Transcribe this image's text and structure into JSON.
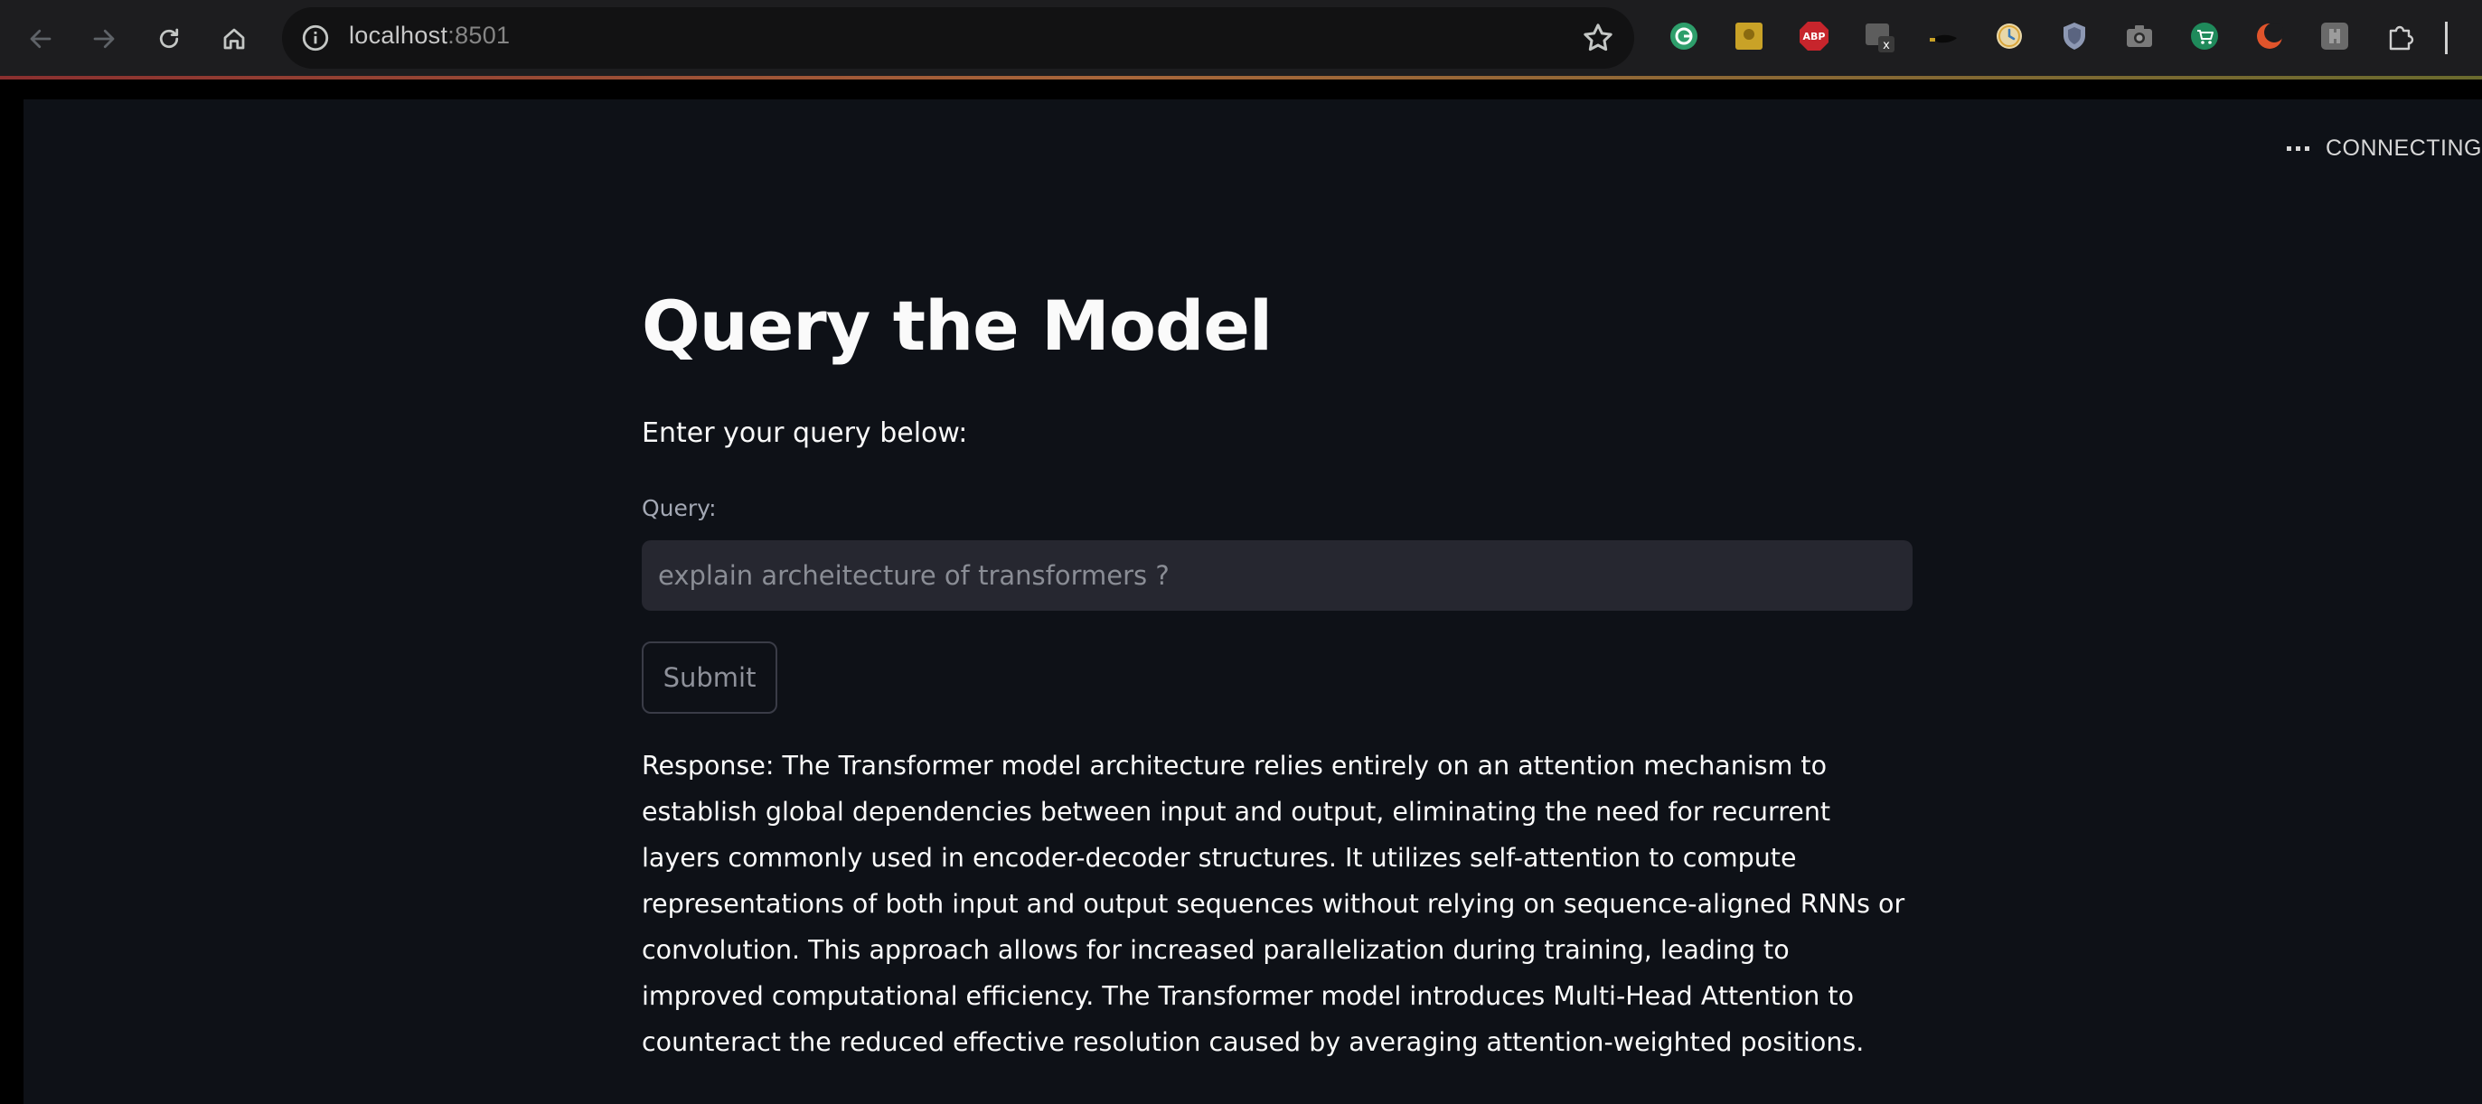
{
  "browser": {
    "url_host": "localhost",
    "url_port": ":8501",
    "nav_icons": [
      "back-arrow-icon",
      "forward-arrow-icon",
      "reload-icon",
      "home-icon"
    ],
    "extensions": [
      {
        "name": "grammarly-icon",
        "color": "#2e9e6b"
      },
      {
        "name": "sticky-note-icon",
        "color": "#c9a227"
      },
      {
        "name": "adblock-plus-icon",
        "color": "#c7252c",
        "label": "ABP"
      },
      {
        "name": "tab-manager-icon",
        "color": "#5d5d5d"
      },
      {
        "name": "whale-icon",
        "color": "#1a1a1a"
      },
      {
        "name": "clock-icon",
        "color": "#d9a53a"
      },
      {
        "name": "shield-icon",
        "color": "#8d98b3"
      },
      {
        "name": "camera-icon",
        "color": "#7a7a7a"
      },
      {
        "name": "cart-icon",
        "color": "#1f8a5b"
      },
      {
        "name": "moon-icon",
        "color": "#e0542b"
      },
      {
        "name": "puzzle-ext-icon",
        "color": "#6a6a6a"
      },
      {
        "name": "extensions-icon",
        "color": "#cfcfcf"
      }
    ]
  },
  "app": {
    "status_label": "CONNECTING",
    "title": "Query the Model",
    "subtitle": "Enter your query below:",
    "query_label": "Query:",
    "query_placeholder": "explain archeitecture of transformers ?",
    "submit_label": "Submit",
    "response_text": "Response: The Transformer model architecture relies entirely on an attention mechanism to establish global dependencies between input and output, eliminating the need for recurrent layers commonly used in encoder-decoder structures. It utilizes self-attention to compute representations of both input and output sequences without relying on sequence-aligned RNNs or convolution. This approach allows for increased parallelization during training, leading to improved computational efficiency. The Transformer model introduces Multi-Head Attention to counteract the reduced effective resolution caused by averaging attention-weighted positions."
  },
  "colors": {
    "background": "#0e1117",
    "input_bg": "#262730",
    "text": "#fafafa",
    "muted": "#a3a8b4"
  }
}
